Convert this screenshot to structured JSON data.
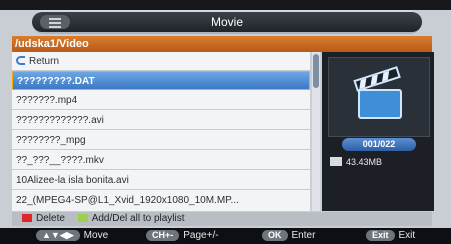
{
  "header": {
    "title": "Movie"
  },
  "path": "/udska1/Video",
  "list": {
    "return_label": "Return",
    "items": [
      {
        "name": "?????????.DAT",
        "selected": true
      },
      {
        "name": "???????.mp4"
      },
      {
        "name": "?????????????.avi"
      },
      {
        "name": "????????_mpg"
      },
      {
        "name": "??_???__????.mkv"
      },
      {
        "name": "10Alizee-la isla bonita.avi"
      },
      {
        "name": "22_(MPEG4-SP@L1_Xvid_1920x1080_10M.MP..."
      }
    ]
  },
  "preview": {
    "counter": "001/022",
    "file_size": "43.43MB"
  },
  "legend": {
    "delete_label": "Delete",
    "playlist_label": "Add/Del all to playlist",
    "red": "#e0262a",
    "green": "#9ccf4a"
  },
  "help": {
    "move_key": "▲▼◀▶",
    "move_label": "Move",
    "page_key": "CH+-",
    "page_label": "Page+/-",
    "enter_key": "OK",
    "enter_label": "Enter",
    "exit_key": "Exit",
    "exit_label": "Exit"
  }
}
